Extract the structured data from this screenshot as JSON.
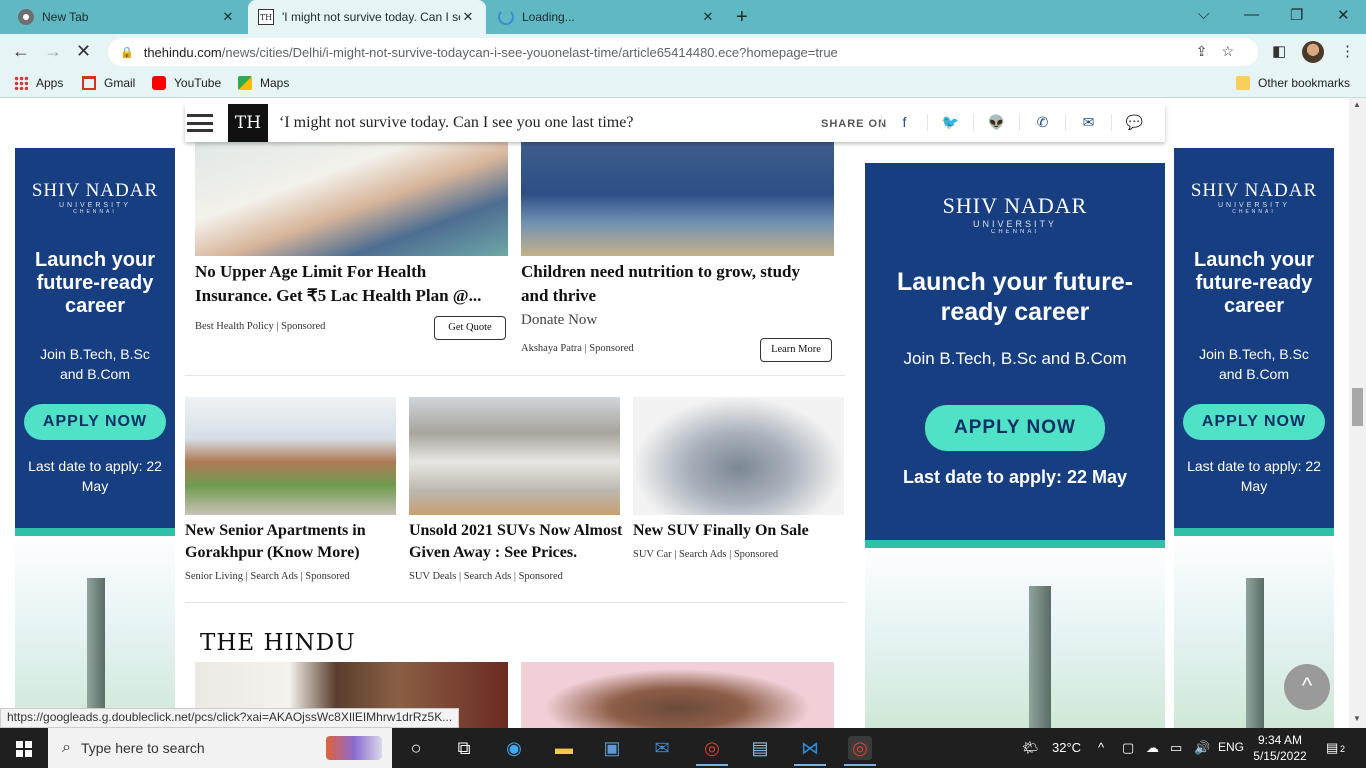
{
  "tabs": [
    {
      "title": "New Tab",
      "favicon": "chrome-icon",
      "active": false
    },
    {
      "title": "'I might not survive today. Can I see",
      "favicon": "the-hindu-icon",
      "active": true
    },
    {
      "title": "Loading...",
      "favicon": "loading-spinner-icon",
      "active": false
    }
  ],
  "window_controls": {
    "tab_search": "⌵",
    "minimize": "—",
    "restore": "❐",
    "close": "✕",
    "new_tab": "+",
    "tab_close": "✕"
  },
  "address": {
    "domain": "thehindu.com",
    "path": "/news/cities/Delhi/i-might-not-survive-todaycan-i-see-youonelast-time/article65414480.ece?homepage=true"
  },
  "bookmarks": [
    {
      "label": "Apps",
      "icon": "apps-grid-icon"
    },
    {
      "label": "Gmail",
      "icon": "gmail-icon"
    },
    {
      "label": "YouTube",
      "icon": "youtube-icon"
    },
    {
      "label": "Maps",
      "icon": "maps-icon"
    }
  ],
  "other_bookmarks": "Other bookmarks",
  "sticky_header": {
    "logo": "TH",
    "title": "‘I might not survive today. Can I see you one last time?",
    "share_label": "SHARE ON",
    "share_icons": [
      "facebook-icon",
      "twitter-icon",
      "reddit-icon",
      "whatsapp-icon",
      "email-icon",
      "comment-icon"
    ],
    "share_glyphs": [
      "f",
      "🐦",
      "👽",
      "✆",
      "✉",
      "💬"
    ]
  },
  "ad": {
    "brand": "SHIV NADAR",
    "university": "UNIVERSITY",
    "city": "CHENNAI",
    "headline": "Launch your future-ready career",
    "programs": "Join B.Tech, B.Sc and B.Com",
    "cta": "APPLY NOW",
    "deadline": "Last date to apply: 22 May"
  },
  "sponsored_top": [
    {
      "title": "No Upper Age Limit For Health Insurance. Get ₹5 Lac Health Plan @...",
      "sub": "",
      "source": "Best Health Policy | Sponsored",
      "button": "Get Quote"
    },
    {
      "title": "Children need nutrition to grow, study and thrive",
      "sub": "Donate Now",
      "source": "Akshaya Patra | Sponsored",
      "button": "Learn More"
    }
  ],
  "sponsored_row": [
    {
      "title": "New Senior Apartments in Gorakhpur (Know More)",
      "source": "Senior Living | Search Ads | Sponsored"
    },
    {
      "title": "Unsold 2021 SUVs Now Almost Given Away : See Prices.",
      "source": "SUV Deals | Search Ads | Sponsored"
    },
    {
      "title": "New SUV Finally On Sale",
      "source": "SUV Car | Search Ads | Sponsored"
    }
  ],
  "hindu_logo": "THE HINDU",
  "status_url": "https://googleads.g.doubleclick.net/pcs/click?xai=AKAOjssWc8XIlEIMhrw1drRz5K...",
  "taskbar": {
    "search_placeholder": "Type here to search",
    "weather": "32°C",
    "language": "ENG",
    "time": "9:34 AM",
    "date": "5/15/2022",
    "notifications": "2"
  }
}
